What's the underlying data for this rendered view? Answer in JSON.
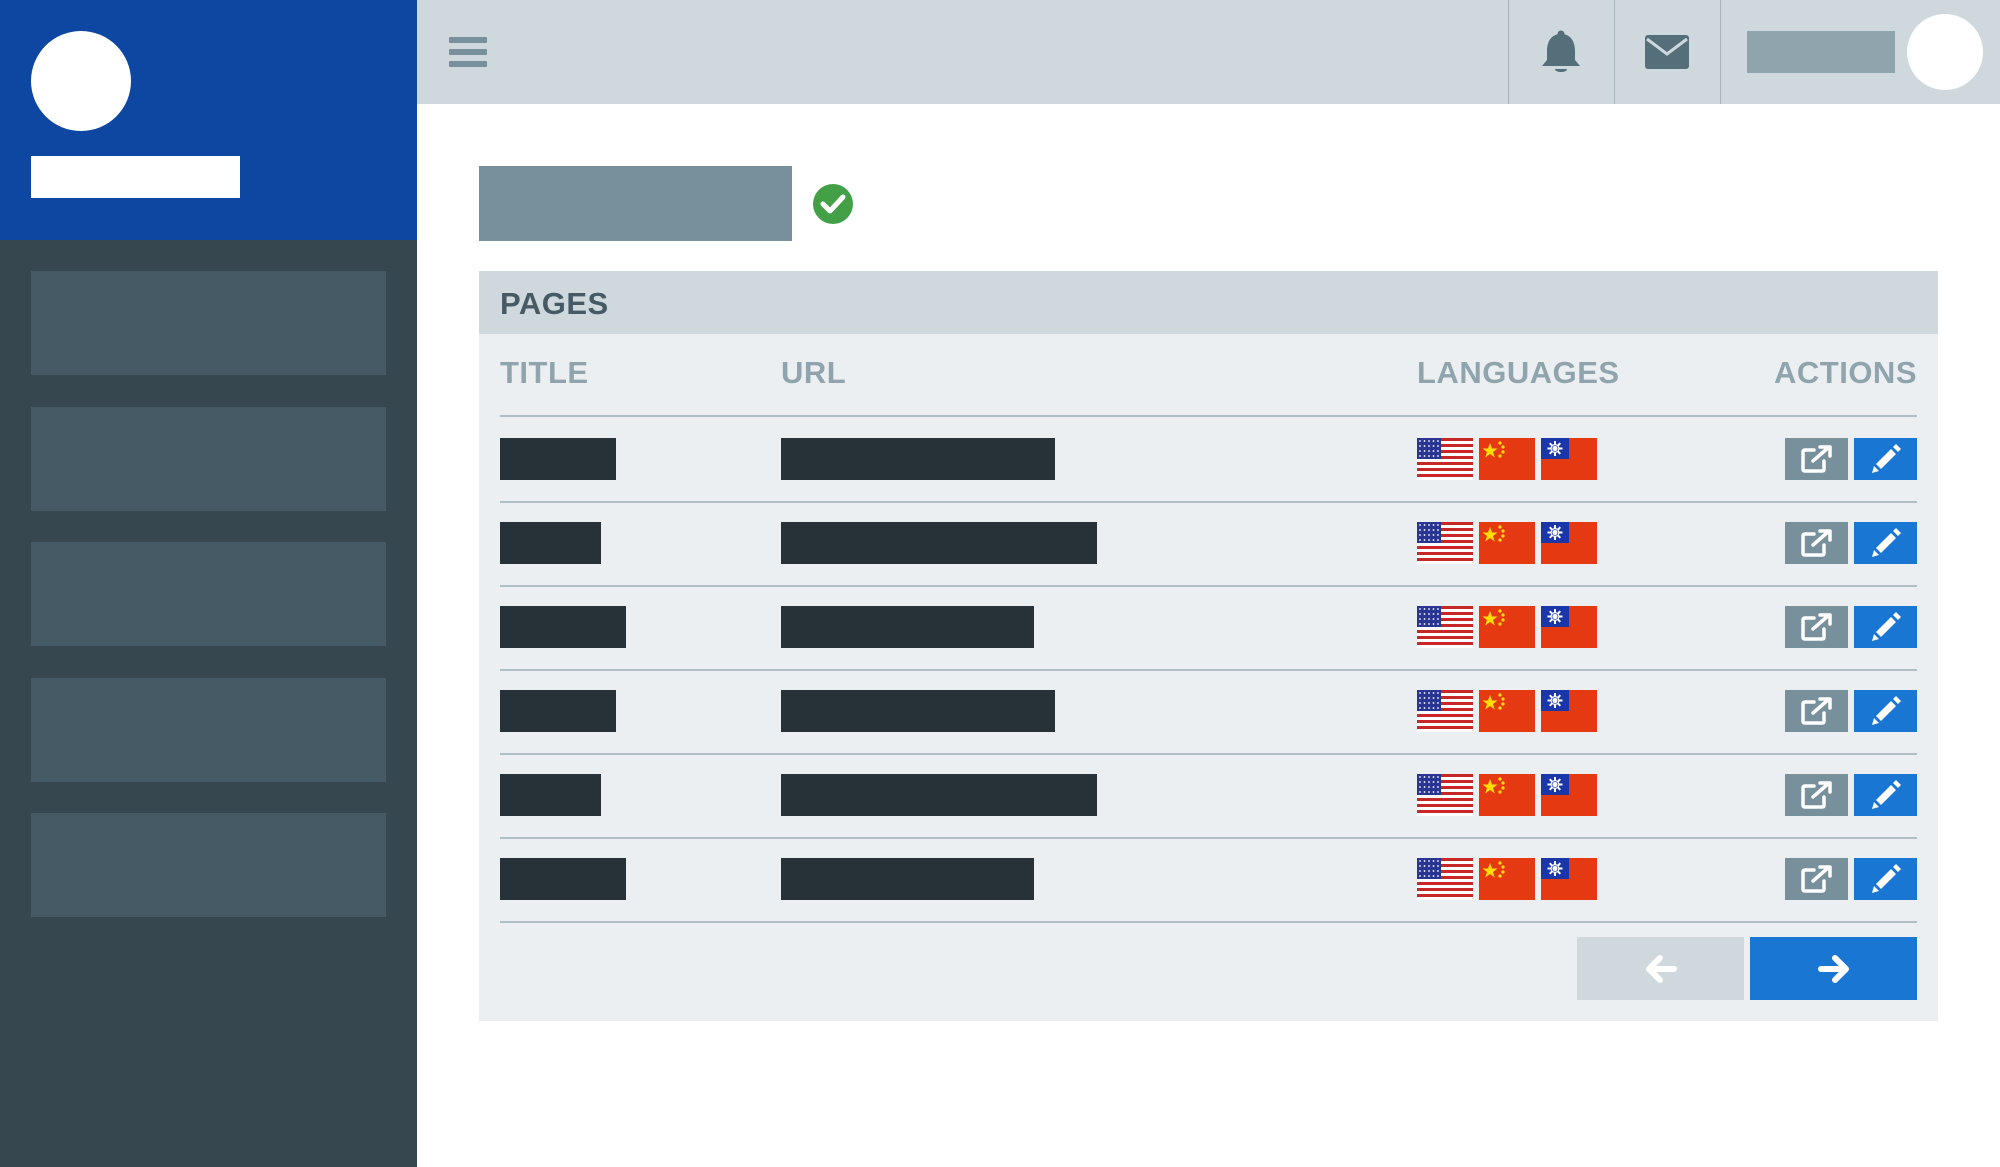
{
  "sidebar": {
    "items": [
      {
        "id": "item-1"
      },
      {
        "id": "item-2"
      },
      {
        "id": "item-3"
      },
      {
        "id": "item-4"
      },
      {
        "id": "item-5"
      }
    ]
  },
  "topbar": {
    "icons": [
      "menu-icon",
      "bell-icon",
      "envelope-icon"
    ]
  },
  "panel": {
    "title": "PAGES",
    "columns": {
      "title": "TITLE",
      "url": "URL",
      "languages": "LANGUAGES",
      "actions": "ACTIONS"
    },
    "rows": [
      {
        "languages": [
          "en-US",
          "zh-CN",
          "zh-TW"
        ]
      },
      {
        "languages": [
          "en-US",
          "zh-CN",
          "zh-TW"
        ]
      },
      {
        "languages": [
          "en-US",
          "zh-CN",
          "zh-TW"
        ]
      },
      {
        "languages": [
          "en-US",
          "zh-CN",
          "zh-TW"
        ]
      },
      {
        "languages": [
          "en-US",
          "zh-CN",
          "zh-TW"
        ]
      },
      {
        "languages": [
          "en-US",
          "zh-CN",
          "zh-TW"
        ]
      }
    ],
    "row_actions": [
      "external-link-icon",
      "pencil-icon"
    ]
  },
  "pagination": {
    "prev_icon": "arrow-left-icon",
    "next_icon": "arrow-right-icon",
    "prev_enabled": false
  },
  "colors": {
    "brand": "#0d47a1",
    "sidebar": "#37474f",
    "primary": "#1976d2",
    "success": "#43a047",
    "muted": "#90a4ae"
  }
}
